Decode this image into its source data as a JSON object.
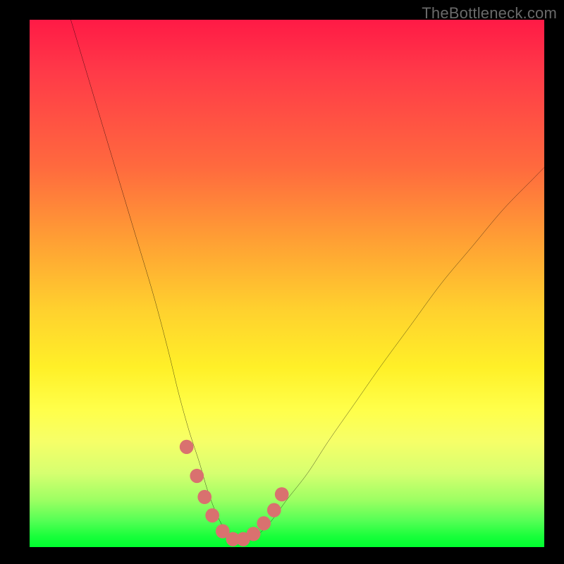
{
  "watermark": "TheBottleneck.com",
  "colors": {
    "background": "#000000",
    "curve_stroke": "#000000",
    "marker_fill": "#d9716f",
    "gradient_top": "#ff1a46",
    "gradient_bottom": "#00ff2f"
  },
  "chart_data": {
    "type": "line",
    "title": "",
    "xlabel": "",
    "ylabel": "",
    "xlim": [
      0,
      100
    ],
    "ylim": [
      0,
      100
    ],
    "grid": false,
    "legend": false,
    "series": [
      {
        "name": "bottleneck-curve",
        "x": [
          8,
          12,
          16,
          20,
          24,
          27,
          29,
          31,
          33,
          34.5,
          36,
          37.5,
          39,
          40.5,
          42,
          44,
          47,
          50,
          54,
          58,
          63,
          68,
          74,
          80,
          86,
          92,
          98,
          100
        ],
        "y": [
          100,
          87,
          74,
          61,
          48,
          37,
          29,
          22,
          16,
          11,
          7,
          4,
          2,
          1,
          1,
          2,
          5,
          9,
          14,
          20,
          27,
          34,
          42,
          50,
          57,
          64,
          70,
          72
        ]
      }
    ],
    "markers": {
      "name": "highlight-dots",
      "x": [
        30.5,
        32.5,
        34,
        35.5,
        37.5,
        39.5,
        41.5,
        43.5,
        45.5,
        47.5,
        49
      ],
      "y": [
        19,
        13.5,
        9.5,
        6,
        3,
        1.5,
        1.5,
        2.5,
        4.5,
        7,
        10
      ]
    }
  }
}
